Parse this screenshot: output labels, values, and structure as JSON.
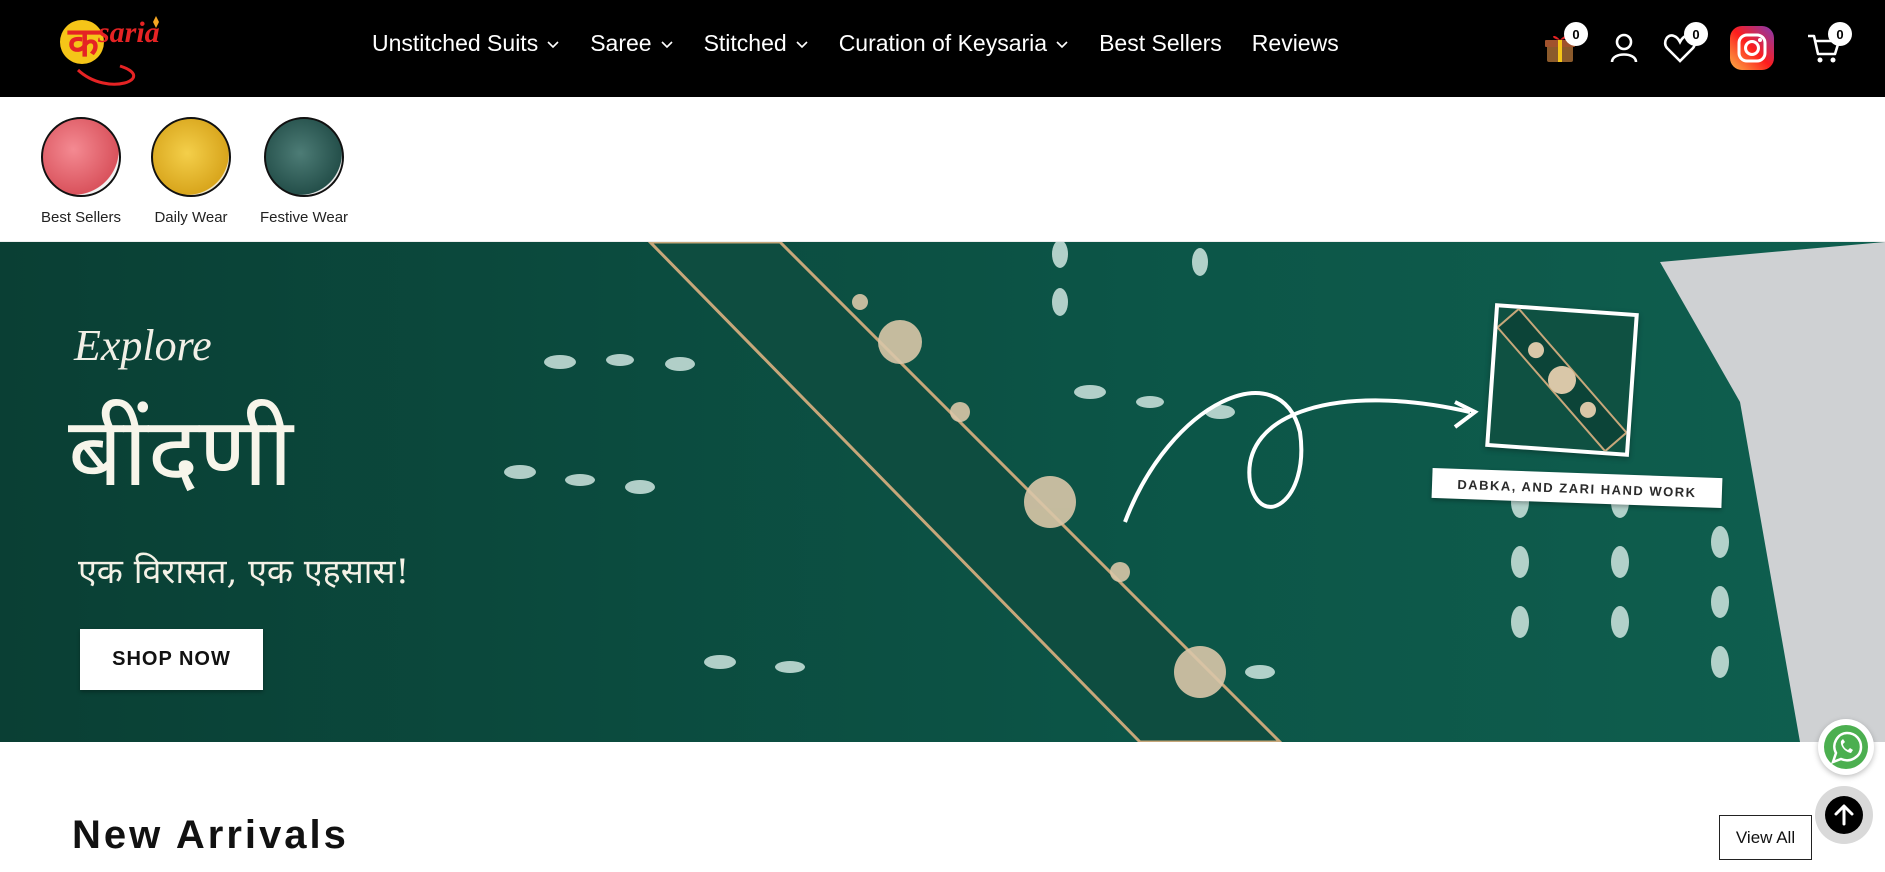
{
  "brand": {
    "logo_text": "saria",
    "logo_glyph": "क",
    "accent": "#e52324",
    "logo_yellow": "#f5c518"
  },
  "nav": {
    "items": [
      {
        "label": "Unstitched Suits",
        "has_dropdown": true
      },
      {
        "label": "Saree",
        "has_dropdown": true
      },
      {
        "label": "Stitched",
        "has_dropdown": true
      },
      {
        "label": "Curation of Keysaria",
        "has_dropdown": true
      },
      {
        "label": "Best Sellers",
        "has_dropdown": false
      },
      {
        "label": "Reviews",
        "has_dropdown": false
      }
    ]
  },
  "header_icons": {
    "gift": {
      "icon": "gift-icon",
      "count": "0"
    },
    "account": {
      "icon": "user-icon"
    },
    "wishlist": {
      "icon": "heart-icon",
      "count": "0"
    },
    "instagram": {
      "icon": "instagram-icon"
    },
    "cart": {
      "icon": "cart-icon",
      "count": "0"
    }
  },
  "categories": [
    {
      "label": "Best Sellers",
      "color": "#e9626b"
    },
    {
      "label": "Daily Wear",
      "color": "#e0b528"
    },
    {
      "label": "Festive Wear",
      "color": "#2d5f5a"
    }
  ],
  "banner": {
    "explore": "Explore",
    "title": "बींदणी",
    "subtitle": "एक विरासत, एक एहसास!",
    "button": "SHOP NOW",
    "tag": "DABKA, AND ZARI HAND WORK",
    "color": "#0b4a3d"
  },
  "new_arrivals": {
    "title": "New Arrivals",
    "view_all": "View All"
  },
  "floating": {
    "whatsapp": "whatsapp-icon",
    "scroll_top": "arrow-up-icon"
  }
}
